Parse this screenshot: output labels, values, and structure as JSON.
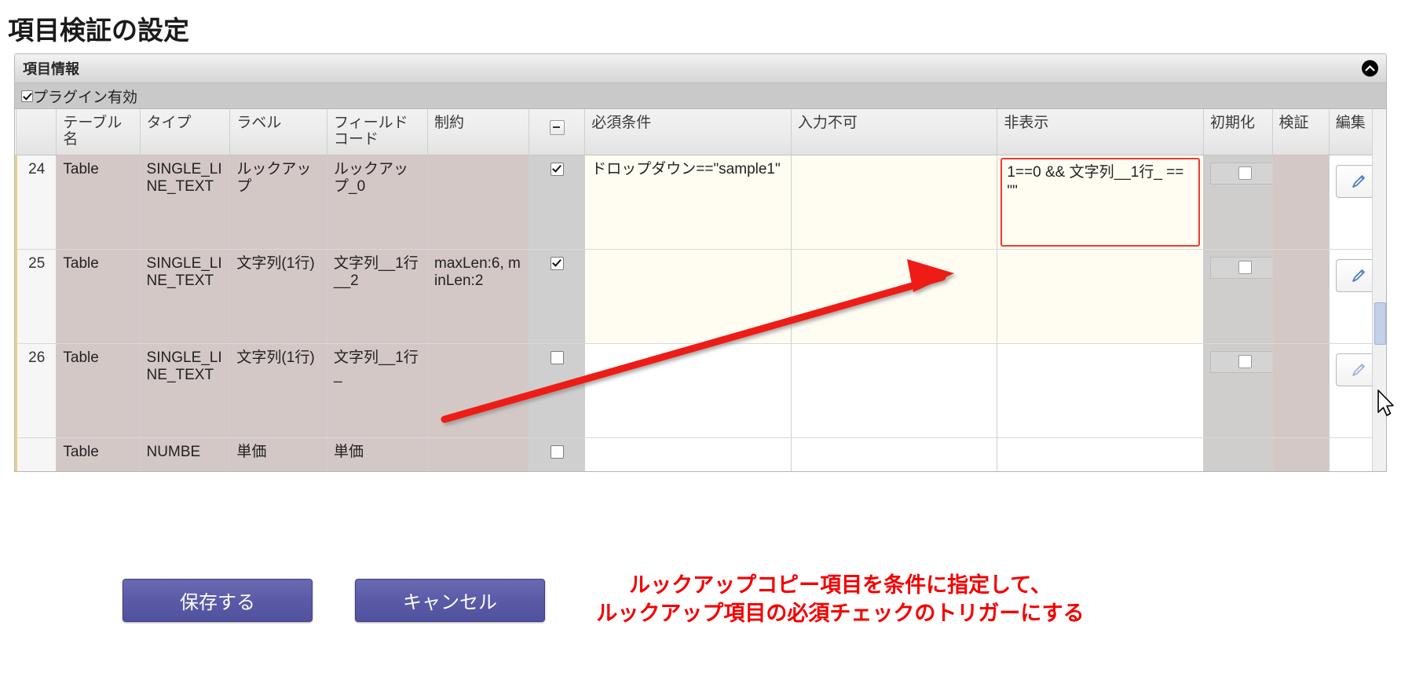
{
  "page": {
    "title": "項目検証の設定"
  },
  "panel": {
    "header_title": "項目情報",
    "collapse_icon": "chevron-up-circle-icon",
    "plugin_checkbox": {
      "label": "プラグイン有効",
      "checked": true
    }
  },
  "grid": {
    "columns": [
      {
        "key": "rownum",
        "label": ""
      },
      {
        "key": "table_name",
        "label": "テーブル名"
      },
      {
        "key": "type",
        "label": "タイプ"
      },
      {
        "key": "label",
        "label": "ラベル"
      },
      {
        "key": "field_code",
        "label": "フィールドコード"
      },
      {
        "key": "constraint",
        "label": "制約"
      },
      {
        "key": "required_flag",
        "label": "minus-toggle-icon"
      },
      {
        "key": "required_cond",
        "label": "必須条件"
      },
      {
        "key": "no_input",
        "label": "入力不可"
      },
      {
        "key": "hidden",
        "label": "非表示"
      },
      {
        "key": "init",
        "label": "初期化"
      },
      {
        "key": "validate",
        "label": "検証"
      },
      {
        "key": "edit",
        "label": "編集"
      }
    ],
    "rows": [
      {
        "rownum": "24",
        "table_name": "Table",
        "type": "SINGLE_LINE_TEXT",
        "label": "ルックアップ",
        "field_code": "ルックアップ_0",
        "constraint": "",
        "required_flag_checked": true,
        "required_cond": "ドロップダウン==\"sample1\"",
        "no_input": "",
        "hidden": "1==0 && 文字列__1行_ == \"\"",
        "hidden_highlighted": true,
        "init_checked": false,
        "validate": "",
        "edit_icon": "pencil-icon"
      },
      {
        "rownum": "25",
        "table_name": "Table",
        "type": "SINGLE_LINE_TEXT",
        "label": "文字列(1行)",
        "field_code": "文字列__1行__2",
        "constraint": "maxLen:6, minLen:2",
        "required_flag_checked": true,
        "required_cond": "",
        "no_input": "",
        "hidden": "",
        "hidden_highlighted": false,
        "init_checked": false,
        "validate": "",
        "edit_icon": "pencil-icon"
      },
      {
        "rownum": "26",
        "table_name": "Table",
        "type": "SINGLE_LINE_TEXT",
        "label": "文字列(1行)",
        "field_code": "文字列__1行_",
        "constraint": "",
        "required_flag_checked": false,
        "required_cond": "",
        "no_input": "",
        "hidden": "",
        "hidden_highlighted": false,
        "init_checked": false,
        "validate": "",
        "edit_icon": "pencil-icon"
      },
      {
        "rownum": "",
        "table_name": "Table",
        "type": "NUMBE",
        "label": "単価",
        "field_code": "単価",
        "constraint": "",
        "required_flag_checked": false,
        "required_cond": "",
        "no_input": "",
        "hidden": "",
        "hidden_highlighted": false,
        "init_checked": false,
        "validate": "",
        "edit_icon": "pencil-icon"
      }
    ]
  },
  "footer": {
    "save_label": "保存する",
    "cancel_label": "キャンセル",
    "annotation": "ルックアップコピー項目を条件に指定して、\nルックアップ項目の必須チェックのトリガーにする",
    "annotation_color": "#f40000",
    "button_color": "#5a5aa8",
    "highlight_color": "#ef3b2d"
  }
}
